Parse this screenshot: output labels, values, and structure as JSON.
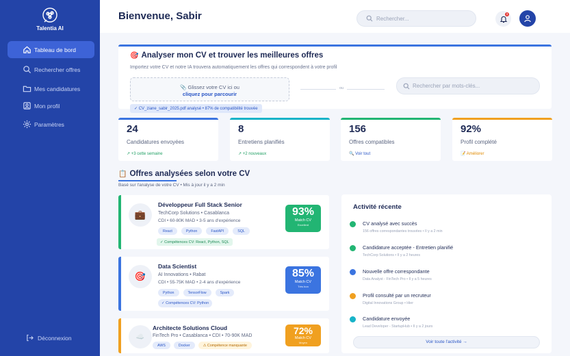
{
  "sidebar": {
    "logo_text": "Talentia AI",
    "items": [
      {
        "label": "Tableau de bord",
        "icon": "home-icon"
      },
      {
        "label": "Rechercher offres",
        "icon": "search-icon"
      },
      {
        "label": "Mes candidatures",
        "icon": "folder-icon"
      },
      {
        "label": "Mon profil",
        "icon": "profile-icon"
      },
      {
        "label": "Paramètres",
        "icon": "gear-icon"
      }
    ],
    "logout_label": "Déconnexion"
  },
  "header": {
    "welcome": "Bienvenue, Sabir",
    "search_placeholder": "Rechercher...",
    "notification_count": "3"
  },
  "cv_section": {
    "title": "Analyser mon CV et trouver les meilleures offres",
    "subtitle": "Importez votre CV et notre IA trouvera automatiquement les offres qui correspondent à votre profil",
    "drop_text": "Glissez votre CV ici ou",
    "drop_link": "cliquez pour parcourir",
    "or_text": "ou",
    "search_placeholder": "Rechercher par mots-clés...",
    "analyzed_status": "✓ CV_ziane_sabir_2025.pdf analysé • 87% de compatibilité trouvée"
  },
  "stats": [
    {
      "value": "24",
      "label": "Candidatures envoyées",
      "foot": "↗ +3 cette semaine",
      "color": "#3b74e0",
      "foot_color": "#22a065"
    },
    {
      "value": "8",
      "label": "Entretiens planifiés",
      "foot": "↗ +2 nouveaux",
      "color": "#17b3c8",
      "foot_color": "#22a065"
    },
    {
      "value": "156",
      "label": "Offres compatibles",
      "foot": "🔍 Voir tout",
      "color": "#22b573",
      "foot_color": "#2a56c6"
    },
    {
      "value": "92%",
      "label": "Profil complété",
      "foot": "📝 Améliorer",
      "color": "#f0a020",
      "foot_color": "#e08a00"
    }
  ],
  "offers_section": {
    "title": "Offres analysées selon votre CV",
    "subtitle": "Basé sur l'analyse de votre CV • Mis à jour il y a 2 min"
  },
  "offers": [
    {
      "icon": "💼",
      "title": "Développeur Full Stack Senior",
      "company": "TechCorp Solutions • Casablanca",
      "meta": "CDI • 60-80K MAD • 3-5 ans d'expérience",
      "tags": [
        "React",
        "Python",
        "FastAPI",
        "SQL"
      ],
      "skills": "✓ Compétences CV: React, Python, SQL",
      "match": "93%",
      "match_label": "Match CV",
      "match_sub": "Excellent",
      "color": "#22b573"
    },
    {
      "icon": "🎯",
      "title": "Data Scientist",
      "company": "AI Innovations • Rabat",
      "meta": "CDI • 55-75K MAD • 2-4 ans d'expérience",
      "tags": [
        "Python",
        "TensorFlow",
        "Spark"
      ],
      "skills": "✓ Compétences CV: Python",
      "match": "85%",
      "match_label": "Match CV",
      "match_sub": "Très bon",
      "color": "#3b74e0"
    },
    {
      "icon": "☁️",
      "title": "Architecte Solutions Cloud",
      "company": "FinTech Pro • Casablanca • CDI • 70-90K MAD",
      "tags": [
        "AWS",
        "Docker"
      ],
      "warn_tag": "⚠ Compétence manquante",
      "match": "72%",
      "match_label": "Match CV",
      "match_sub": "Moyen",
      "color": "#f0a020"
    }
  ],
  "activity": {
    "title": "Activité récente",
    "items": [
      {
        "text": "CV analysé avec succès",
        "sub": "156 offres correspondantes trouvées • Il y a 2 min",
        "color": "#22b573"
      },
      {
        "text": "Candidature acceptée - Entretien planifié",
        "sub": "TechCorp Solutions • Il y a 2 heures",
        "color": "#22b573"
      },
      {
        "text": "Nouvelle offre correspondante",
        "sub": "Data Analyst - FinTech Pro • Il y a 5 heures",
        "color": "#3b74e0"
      },
      {
        "text": "Profil consulté par un recruteur",
        "sub": "Digital Innovations Group • Hier",
        "color": "#f0a020"
      },
      {
        "text": "Candidature envoyée",
        "sub": "Lead Developer - StartupHub • Il y a 2 jours",
        "color": "#17b3c8"
      }
    ],
    "button": "Voir toute l'activité →"
  }
}
